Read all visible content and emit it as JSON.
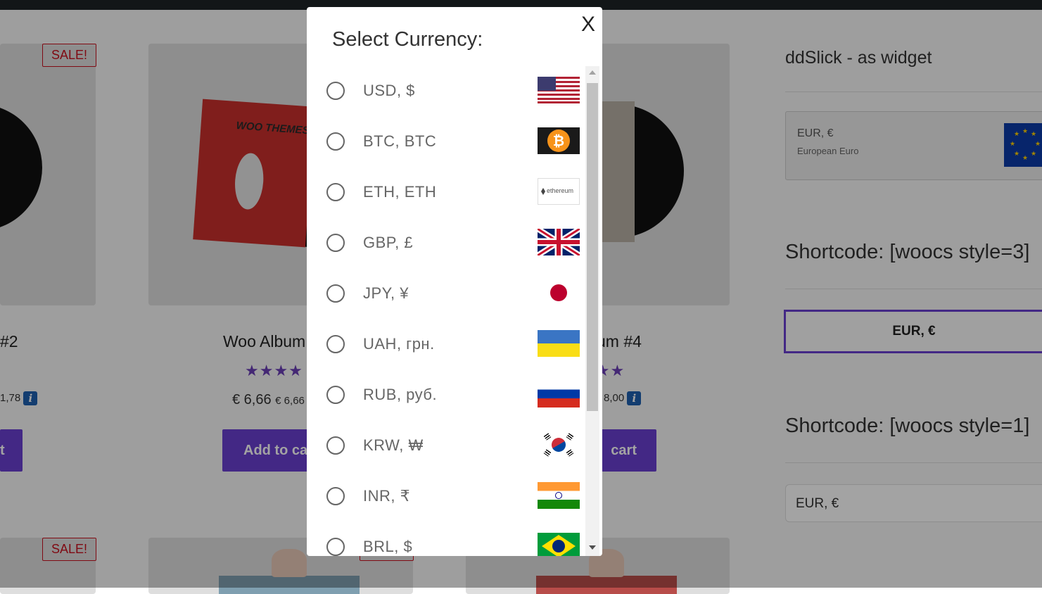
{
  "products": {
    "sale_label": "SALE!",
    "card1": {
      "title": "#2",
      "price": "1,78"
    },
    "card2": {
      "title": "Woo Album",
      "price_main": "€ 6,66",
      "price_small": "€ 6,66",
      "button": "Add to cart",
      "sleeve_text": "WOO THEMES"
    },
    "card3": {
      "title": "um #4",
      "price": "8,00",
      "button": "cart"
    },
    "card1_button": "t",
    "info_glyph": "i",
    "stars": "★★★★",
    "stars_partial": "★★★"
  },
  "sidebar": {
    "ddslick_title": "ddSlick - as widget",
    "ddslick_code": "EUR, €",
    "ddslick_name": "European Euro",
    "style3_title": "Shortcode: [woocs style=3]",
    "style3_value": "EUR, €",
    "style1_title": "Shortcode: [woocs style=1]",
    "style1_value": "EUR, €"
  },
  "modal": {
    "title": "Select Currency:",
    "close_label": "X",
    "currencies": [
      {
        "label": "USD, $",
        "flag": "us-flag"
      },
      {
        "label": "BTC, BTC",
        "flag": "bitcoin-logo"
      },
      {
        "label": "ETH, ETH",
        "flag": "ethereum-logo",
        "flag_text": "ethereum"
      },
      {
        "label": "GBP, £",
        "flag": "uk-flag"
      },
      {
        "label": "JPY, ¥",
        "flag": "japan-flag"
      },
      {
        "label": "UAH, грн.",
        "flag": "ukraine-flag"
      },
      {
        "label": "RUB, руб.",
        "flag": "russia-flag"
      },
      {
        "label": "KRW, ₩",
        "flag": "korea-flag"
      },
      {
        "label": "INR, ₹",
        "flag": "india-flag"
      },
      {
        "label": "BRL, $",
        "flag": "brazil-flag"
      }
    ],
    "bitcoin_glyph": "₿"
  },
  "colors": {
    "accent": "#6a3fd0",
    "sale": "#c8101e",
    "overlay": "rgba(0,0,0,0.36)"
  }
}
